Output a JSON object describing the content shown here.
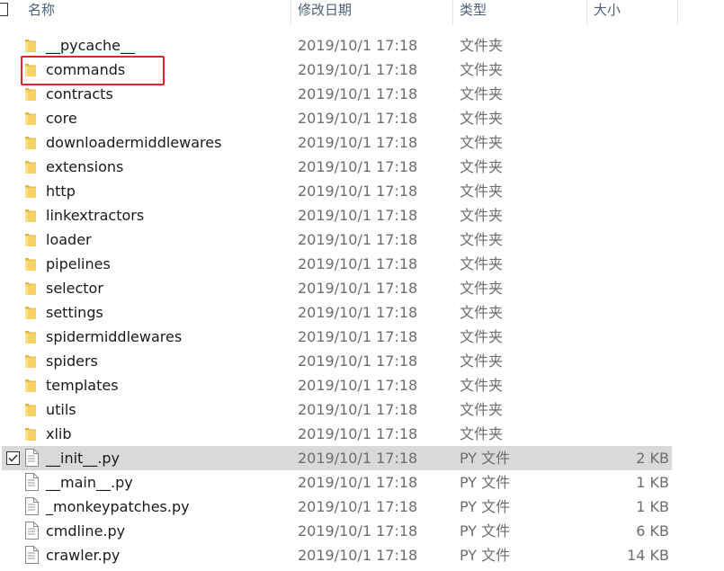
{
  "columns": {
    "name": "名称",
    "date": "修改日期",
    "type": "类型",
    "size": "大小"
  },
  "colors": {
    "header_text": "#4c607a",
    "selected_row": "#d9d9d9",
    "highlight_box": "#e0262a",
    "folder_yellow": "#f6c84a"
  },
  "files": [
    {
      "name": "__pycache__",
      "date": "2019/10/1 17:18",
      "type": "文件夹",
      "size": "",
      "icon": "folder-icon",
      "selected": false
    },
    {
      "name": "commands",
      "date": "2019/10/1 17:18",
      "type": "文件夹",
      "size": "",
      "icon": "folder-icon",
      "selected": false
    },
    {
      "name": "contracts",
      "date": "2019/10/1 17:18",
      "type": "文件夹",
      "size": "",
      "icon": "folder-icon",
      "selected": false
    },
    {
      "name": "core",
      "date": "2019/10/1 17:18",
      "type": "文件夹",
      "size": "",
      "icon": "folder-icon",
      "selected": false
    },
    {
      "name": "downloadermiddlewares",
      "date": "2019/10/1 17:18",
      "type": "文件夹",
      "size": "",
      "icon": "folder-icon",
      "selected": false
    },
    {
      "name": "extensions",
      "date": "2019/10/1 17:18",
      "type": "文件夹",
      "size": "",
      "icon": "folder-icon",
      "selected": false
    },
    {
      "name": "http",
      "date": "2019/10/1 17:18",
      "type": "文件夹",
      "size": "",
      "icon": "folder-icon",
      "selected": false
    },
    {
      "name": "linkextractors",
      "date": "2019/10/1 17:18",
      "type": "文件夹",
      "size": "",
      "icon": "folder-icon",
      "selected": false
    },
    {
      "name": "loader",
      "date": "2019/10/1 17:18",
      "type": "文件夹",
      "size": "",
      "icon": "folder-icon",
      "selected": false
    },
    {
      "name": "pipelines",
      "date": "2019/10/1 17:18",
      "type": "文件夹",
      "size": "",
      "icon": "folder-icon",
      "selected": false
    },
    {
      "name": "selector",
      "date": "2019/10/1 17:18",
      "type": "文件夹",
      "size": "",
      "icon": "folder-icon",
      "selected": false
    },
    {
      "name": "settings",
      "date": "2019/10/1 17:18",
      "type": "文件夹",
      "size": "",
      "icon": "folder-icon",
      "selected": false
    },
    {
      "name": "spidermiddlewares",
      "date": "2019/10/1 17:18",
      "type": "文件夹",
      "size": "",
      "icon": "folder-icon",
      "selected": false
    },
    {
      "name": "spiders",
      "date": "2019/10/1 17:18",
      "type": "文件夹",
      "size": "",
      "icon": "folder-icon",
      "selected": false
    },
    {
      "name": "templates",
      "date": "2019/10/1 17:18",
      "type": "文件夹",
      "size": "",
      "icon": "folder-icon",
      "selected": false
    },
    {
      "name": "utils",
      "date": "2019/10/1 17:18",
      "type": "文件夹",
      "size": "",
      "icon": "folder-icon",
      "selected": false
    },
    {
      "name": "xlib",
      "date": "2019/10/1 17:18",
      "type": "文件夹",
      "size": "",
      "icon": "folder-icon",
      "selected": false
    },
    {
      "name": "__init__.py",
      "date": "2019/10/1 17:18",
      "type": "PY 文件",
      "size": "2 KB",
      "icon": "file-icon",
      "selected": true
    },
    {
      "name": "__main__.py",
      "date": "2019/10/1 17:18",
      "type": "PY 文件",
      "size": "1 KB",
      "icon": "file-icon",
      "selected": false
    },
    {
      "name": "_monkeypatches.py",
      "date": "2019/10/1 17:18",
      "type": "PY 文件",
      "size": "1 KB",
      "icon": "file-icon",
      "selected": false
    },
    {
      "name": "cmdline.py",
      "date": "2019/10/1 17:18",
      "type": "PY 文件",
      "size": "6 KB",
      "icon": "file-icon",
      "selected": false
    },
    {
      "name": "crawler.py",
      "date": "2019/10/1 17:18",
      "type": "PY 文件",
      "size": "14 KB",
      "icon": "file-icon",
      "selected": false
    }
  ]
}
